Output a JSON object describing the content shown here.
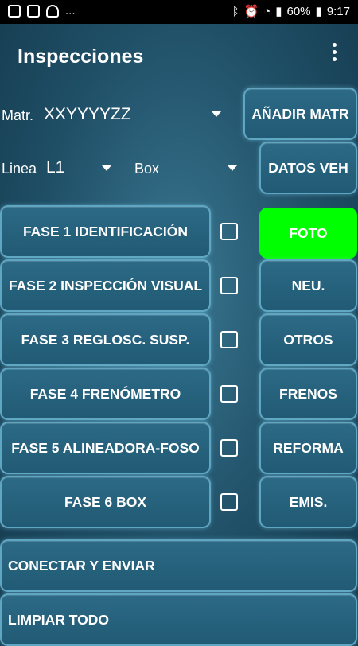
{
  "status": {
    "left_icons": [
      "image-icon",
      "gallery-icon",
      "hand-icon"
    ],
    "overflow": "...",
    "battery": "60%",
    "time": "9:17"
  },
  "appbar": {
    "title": "Inspecciones",
    "menu_icon": "more-vertical-icon"
  },
  "matr": {
    "label": "Matr.",
    "value": "XXYYYYZZ",
    "button": "AÑADIR MATR"
  },
  "linea": {
    "label": "Linea",
    "value": "L1",
    "box_value": "Box",
    "button": "DATOS VEH"
  },
  "phases": [
    {
      "label": "FASE 1 IDENTIFICACIÓN",
      "checked": false,
      "side": "FOTO"
    },
    {
      "label": "FASE 2 INSPECCIÓN VISUAL",
      "checked": false,
      "side": "NEU."
    },
    {
      "label": "FASE 3 REGLOSC. SUSP.",
      "checked": false,
      "side": "OTROS"
    },
    {
      "label": "FASE 4 FRENÓMETRO",
      "checked": false,
      "side": "FRENOS"
    },
    {
      "label": "FASE 5 ALINEADORA-FOSO",
      "checked": false,
      "side": "REFORMA"
    },
    {
      "label": "FASE 6 BOX",
      "checked": false,
      "side": "EMIS."
    }
  ],
  "actions": {
    "connect": "CONECTAR Y ENVIAR",
    "clear": "LIMPIAR TODO"
  },
  "colors": {
    "highlight": "#00ff00"
  }
}
